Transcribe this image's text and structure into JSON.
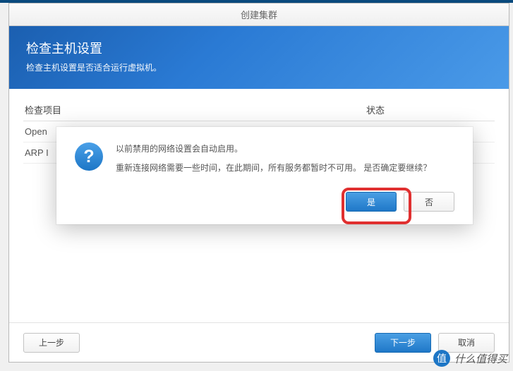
{
  "titlebar": {
    "title": "创建集群"
  },
  "header": {
    "title": "检查主机设置",
    "subtitle": "检查主机设置是否适合运行虚拟机。"
  },
  "grid": {
    "col1_header": "检查项目",
    "col2_header": "状态",
    "rows": [
      {
        "name": "Open"
      },
      {
        "name": "ARP I"
      }
    ]
  },
  "dialog": {
    "icon_glyph": "?",
    "line1": "以前禁用的网络设置会自动启用。",
    "line2": "重新连接网络需要一些时间，在此期间，所有服务都暂时不可用。 是否确定要继续？",
    "yes_label": "是",
    "no_label": "否"
  },
  "footer": {
    "prev_label": "上一步",
    "next_label": "下一步",
    "cancel_label": "取消"
  },
  "watermark": {
    "badge": "值",
    "text": "什么值得买"
  }
}
